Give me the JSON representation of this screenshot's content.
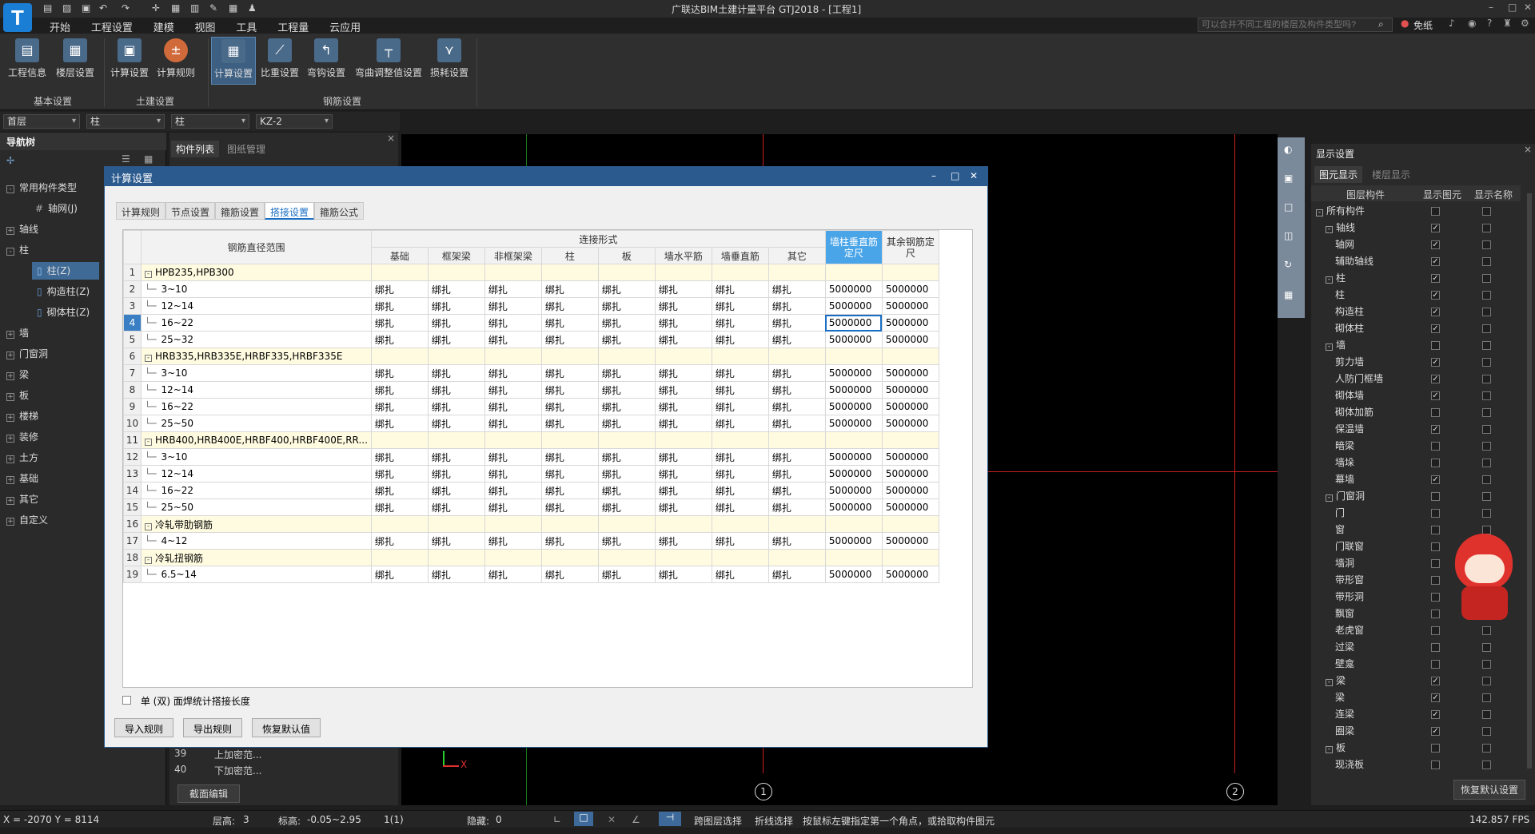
{
  "app": {
    "title": "广联达BIM土建计量平台 GTJ2018 - [工程1]",
    "logo": "T",
    "search_placeholder": "可以合并不同工程的楼层及构件类型吗?",
    "user": "免纸"
  },
  "menu": [
    "开始",
    "工程设置",
    "建模",
    "视图",
    "工具",
    "工程量",
    "云应用"
  ],
  "ribbon": {
    "buttons": [
      {
        "label": "工程信息",
        "icon": "info-icon"
      },
      {
        "label": "楼层设置",
        "icon": "floor-icon"
      },
      {
        "label": "计算设置",
        "icon": "calc-icon"
      },
      {
        "label": "计算规则",
        "icon": "rule-icon"
      },
      {
        "label": "计算设置",
        "icon": "rebar-calc-icon",
        "active": true
      },
      {
        "label": "比重设置",
        "icon": "weight-icon"
      },
      {
        "label": "弯钩设置",
        "icon": "hook-icon"
      },
      {
        "label": "弯曲调整值设置",
        "icon": "bend-icon"
      },
      {
        "label": "损耗设置",
        "icon": "loss-icon"
      }
    ],
    "groups": [
      "基本设置",
      "土建设置",
      "钢筋设置"
    ]
  },
  "selectors": [
    "首层",
    "柱",
    "柱",
    "KZ-2"
  ],
  "nav": {
    "title": "导航树",
    "items": [
      {
        "label": "常用构件类型",
        "level": 0
      },
      {
        "label": "轴网(J)",
        "level": 1
      },
      {
        "label": "轴线",
        "level": 0
      },
      {
        "label": "柱",
        "level": 0
      },
      {
        "label": "柱(Z)",
        "level": 1,
        "selected": true
      },
      {
        "label": "构造柱(Z)",
        "level": 1
      },
      {
        "label": "砌体柱(Z)",
        "level": 1
      },
      {
        "label": "墙",
        "level": 0
      },
      {
        "label": "门窗洞",
        "level": 0
      },
      {
        "label": "梁",
        "level": 0
      },
      {
        "label": "板",
        "level": 0
      },
      {
        "label": "楼梯",
        "level": 0
      },
      {
        "label": "装修",
        "level": 0
      },
      {
        "label": "土方",
        "level": 0
      },
      {
        "label": "基础",
        "level": 0
      },
      {
        "label": "其它",
        "level": 0
      },
      {
        "label": "自定义",
        "level": 0
      }
    ]
  },
  "complist": {
    "tabs": [
      "构件列表",
      "图纸管理"
    ],
    "rows": [
      {
        "idx": "39",
        "label": "上加密范..."
      },
      {
        "idx": "40",
        "label": "下加密范..."
      }
    ],
    "button": "截面编辑"
  },
  "canvas": {
    "axis1": "1",
    "axis2": "2",
    "axis_x": "X"
  },
  "display": {
    "title": "显示设置",
    "tabs": [
      "图元显示",
      "楼层显示"
    ],
    "cols": [
      "图层构件",
      "显示图元",
      "显示名称"
    ],
    "rows": [
      {
        "label": "所有构件",
        "level": 0,
        "show": false,
        "name": false
      },
      {
        "label": "轴线",
        "level": 1,
        "show": true,
        "name": false
      },
      {
        "label": "轴网",
        "level": 2,
        "show": true,
        "name": false
      },
      {
        "label": "辅助轴线",
        "level": 2,
        "show": true,
        "name": false
      },
      {
        "label": "柱",
        "level": 1,
        "show": true,
        "name": false
      },
      {
        "label": "柱",
        "level": 2,
        "show": true,
        "name": false
      },
      {
        "label": "构造柱",
        "level": 2,
        "show": true,
        "name": false
      },
      {
        "label": "砌体柱",
        "level": 2,
        "show": true,
        "name": false
      },
      {
        "label": "墙",
        "level": 1,
        "show": false,
        "name": false
      },
      {
        "label": "剪力墙",
        "level": 2,
        "show": true,
        "name": false
      },
      {
        "label": "人防门框墙",
        "level": 2,
        "show": true,
        "name": false
      },
      {
        "label": "砌体墙",
        "level": 2,
        "show": true,
        "name": false
      },
      {
        "label": "砌体加筋",
        "level": 2,
        "show": false,
        "name": false
      },
      {
        "label": "保温墙",
        "level": 2,
        "show": true,
        "name": false
      },
      {
        "label": "暗梁",
        "level": 2,
        "show": false,
        "name": false
      },
      {
        "label": "墙垛",
        "level": 2,
        "show": false,
        "name": false
      },
      {
        "label": "幕墙",
        "level": 2,
        "show": true,
        "name": false
      },
      {
        "label": "门窗洞",
        "level": 1,
        "show": false,
        "name": false
      },
      {
        "label": "门",
        "level": 2,
        "show": false,
        "name": false
      },
      {
        "label": "窗",
        "level": 2,
        "show": false,
        "name": false
      },
      {
        "label": "门联窗",
        "level": 2,
        "show": false,
        "name": false
      },
      {
        "label": "墙洞",
        "level": 2,
        "show": false,
        "name": false
      },
      {
        "label": "带形窗",
        "level": 2,
        "show": false,
        "name": false
      },
      {
        "label": "带形洞",
        "level": 2,
        "show": false,
        "name": false
      },
      {
        "label": "飘窗",
        "level": 2,
        "show": false,
        "name": false
      },
      {
        "label": "老虎窗",
        "level": 2,
        "show": false,
        "name": false
      },
      {
        "label": "过梁",
        "level": 2,
        "show": false,
        "name": false
      },
      {
        "label": "壁龛",
        "level": 2,
        "show": false,
        "name": false
      },
      {
        "label": "梁",
        "level": 1,
        "show": true,
        "name": false
      },
      {
        "label": "梁",
        "level": 2,
        "show": true,
        "name": false
      },
      {
        "label": "连梁",
        "level": 2,
        "show": true,
        "name": false
      },
      {
        "label": "圈梁",
        "level": 2,
        "show": true,
        "name": false
      },
      {
        "label": "板",
        "level": 1,
        "show": false,
        "name": false
      },
      {
        "label": "现浇板",
        "level": 2,
        "show": false,
        "name": false
      }
    ],
    "restore": "恢复默认设置"
  },
  "status": {
    "coords": "X = -2070 Y = 8114",
    "floor_height_label": "层高:",
    "floor_height": "3",
    "elev_label": "标高:",
    "elev": "-0.05~2.95",
    "count": "1(1)",
    "hidden_label": "隐藏:",
    "hidden": "0",
    "cross_layer": "跨图层选择",
    "polyline": "折线选择",
    "hint": "按鼠标左键指定第一个角点，或拾取构件图元",
    "fps": "142.857 FPS"
  },
  "dialog": {
    "title": "计算设置",
    "tabs": [
      "计算规则",
      "节点设置",
      "箍筋设置",
      "搭接设置",
      "箍筋公式"
    ],
    "active_tab": 3,
    "header_range": "钢筋直径范围",
    "header_group": "连接形式",
    "header_cols": [
      "基础",
      "框架梁",
      "非框架梁",
      "柱",
      "板",
      "墙水平筋",
      "墙垂直筋",
      "其它"
    ],
    "header_len1": "墙柱垂直筋定尺",
    "header_len2": "其余钢筋定尺",
    "rows": [
      {
        "idx": "1",
        "group": true,
        "label": "HPB235,HPB300"
      },
      {
        "idx": "2",
        "label": "3~10",
        "conn": "绑扎",
        "l1": "5000000",
        "l2": "5000000"
      },
      {
        "idx": "3",
        "label": "12~14",
        "conn": "绑扎",
        "l1": "5000000",
        "l2": "5000000"
      },
      {
        "idx": "4",
        "label": "16~22",
        "conn": "绑扎",
        "l1": "5000000",
        "l2": "5000000",
        "current": true
      },
      {
        "idx": "5",
        "label": "25~32",
        "conn": "绑扎",
        "l1": "5000000",
        "l2": "5000000"
      },
      {
        "idx": "6",
        "group": true,
        "label": "HRB335,HRB335E,HRBF335,HRBF335E"
      },
      {
        "idx": "7",
        "label": "3~10",
        "conn": "绑扎",
        "l1": "5000000",
        "l2": "5000000"
      },
      {
        "idx": "8",
        "label": "12~14",
        "conn": "绑扎",
        "l1": "5000000",
        "l2": "5000000"
      },
      {
        "idx": "9",
        "label": "16~22",
        "conn": "绑扎",
        "l1": "5000000",
        "l2": "5000000"
      },
      {
        "idx": "10",
        "label": "25~50",
        "conn": "绑扎",
        "l1": "5000000",
        "l2": "5000000"
      },
      {
        "idx": "11",
        "group": true,
        "label": "HRB400,HRB400E,HRBF400,HRBF400E,RR..."
      },
      {
        "idx": "12",
        "label": "3~10",
        "conn": "绑扎",
        "l1": "5000000",
        "l2": "5000000"
      },
      {
        "idx": "13",
        "label": "12~14",
        "conn": "绑扎",
        "l1": "5000000",
        "l2": "5000000"
      },
      {
        "idx": "14",
        "label": "16~22",
        "conn": "绑扎",
        "l1": "5000000",
        "l2": "5000000"
      },
      {
        "idx": "15",
        "label": "25~50",
        "conn": "绑扎",
        "l1": "5000000",
        "l2": "5000000"
      },
      {
        "idx": "16",
        "group": true,
        "label": "冷轧带肋钢筋"
      },
      {
        "idx": "17",
        "label": "4~12",
        "conn": "绑扎",
        "l1": "5000000",
        "l2": "5000000"
      },
      {
        "idx": "18",
        "group": true,
        "label": "冷轧扭钢筋"
      },
      {
        "idx": "19",
        "label": "6.5~14",
        "conn": "绑扎",
        "l1": "5000000",
        "l2": "5000000"
      }
    ],
    "checkbox_label": "单 (双) 面焊统计搭接长度",
    "buttons": [
      "导入规则",
      "导出规则",
      "恢复默认值"
    ]
  }
}
